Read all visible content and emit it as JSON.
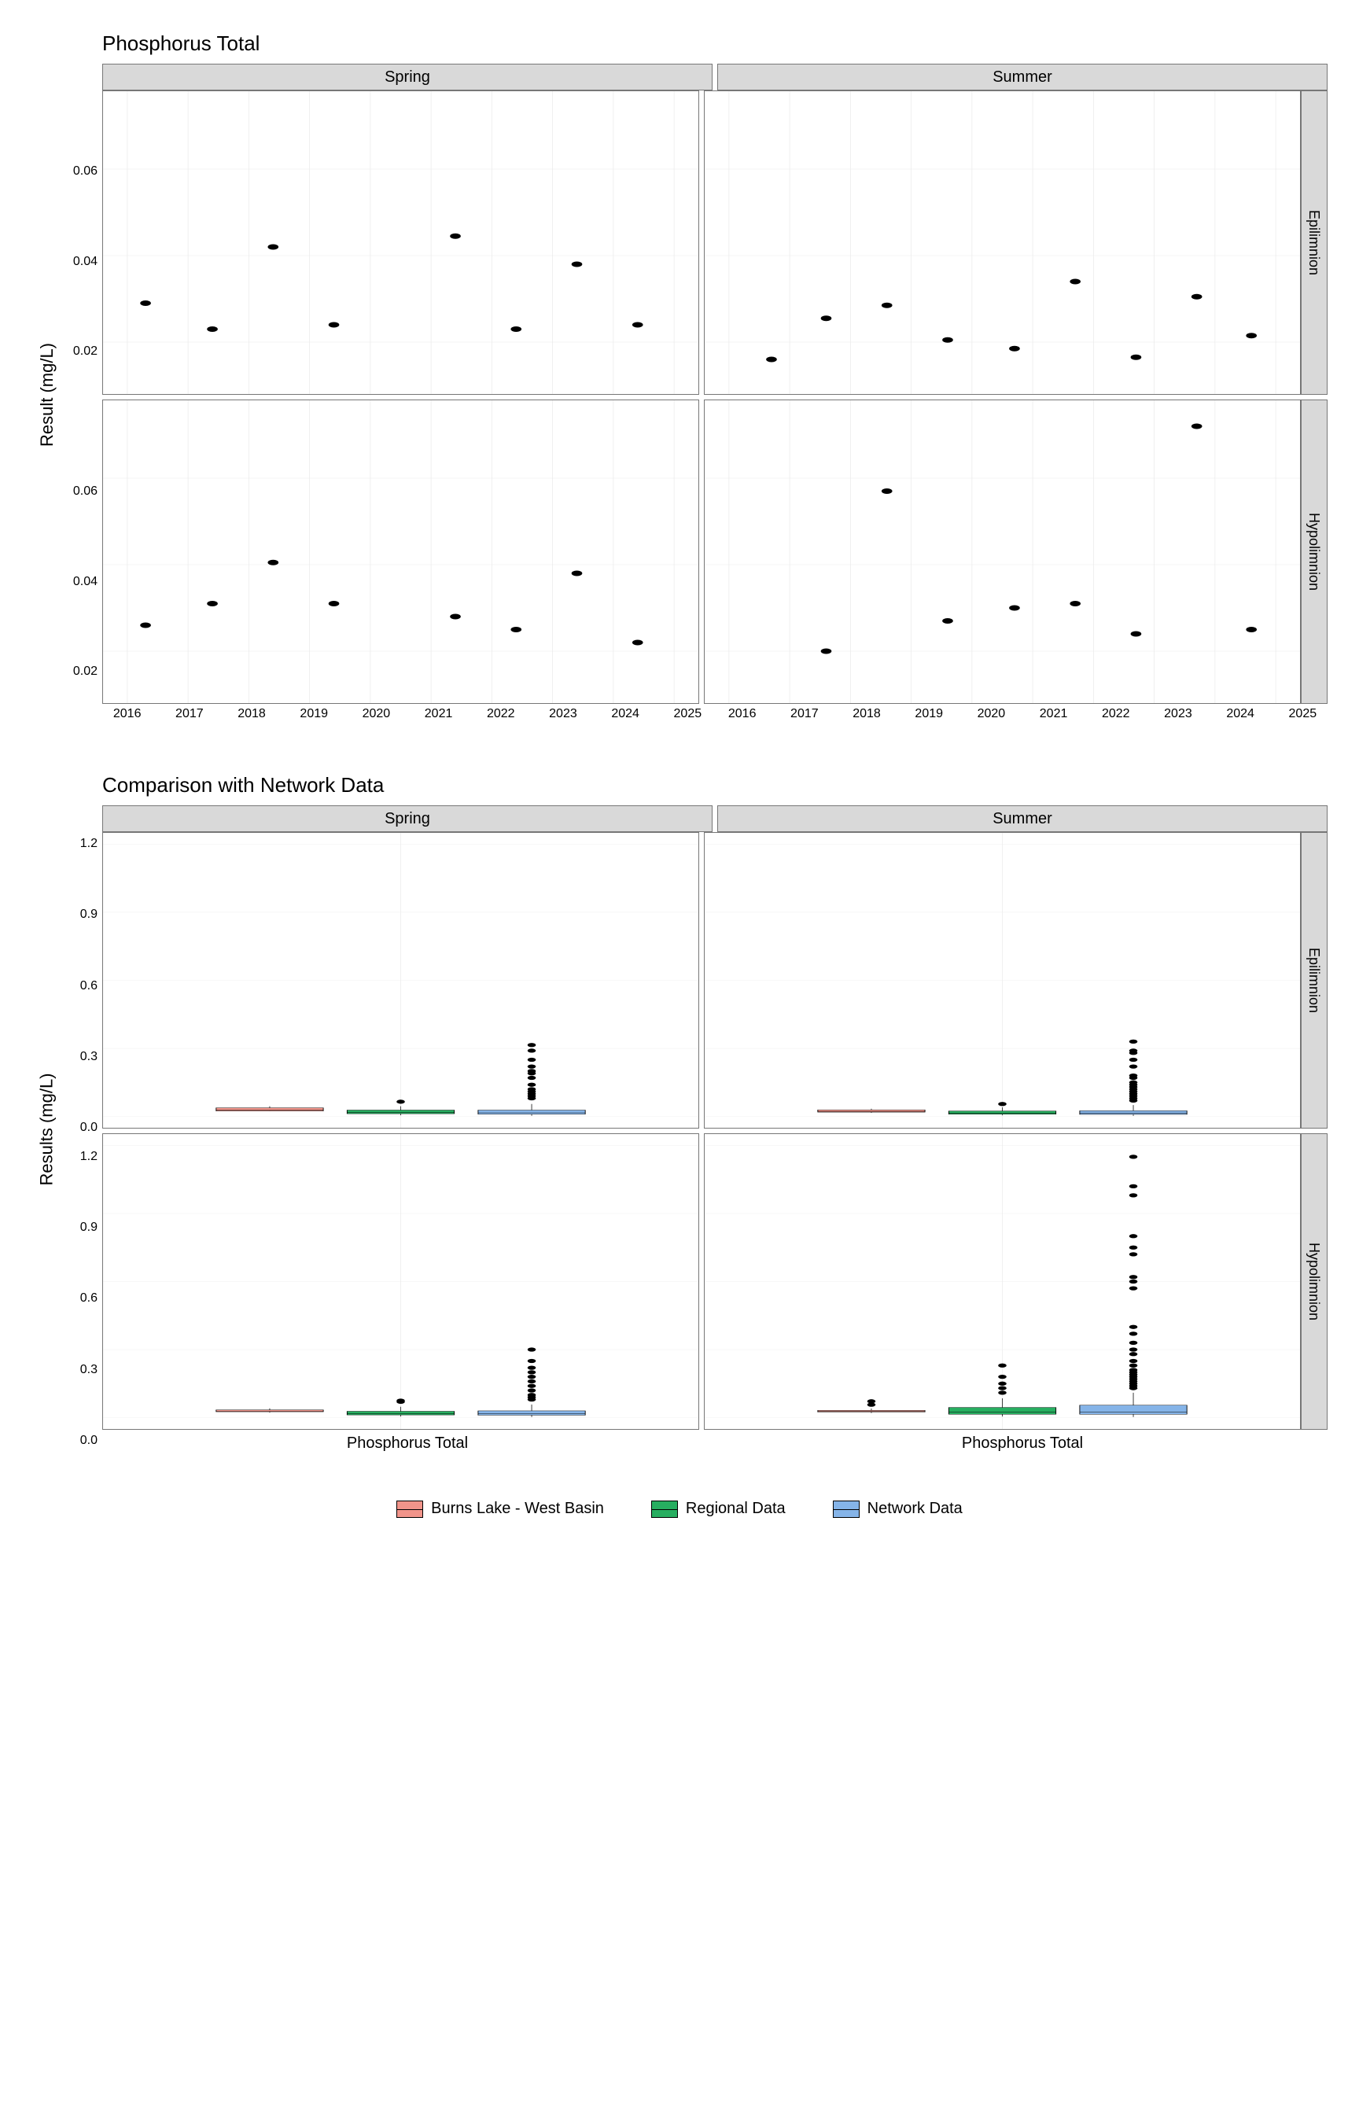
{
  "chart1": {
    "title": "Phosphorus Total",
    "ylabel": "Result (mg/L)",
    "col_facets": [
      "Spring",
      "Summer"
    ],
    "row_facets": [
      "Epilimnion",
      "Hypolimnion"
    ],
    "x_ticks": [
      2016,
      2017,
      2018,
      2019,
      2020,
      2021,
      2022,
      2023,
      2024,
      2025
    ],
    "y_ticks": [
      0.02,
      0.04,
      0.06
    ],
    "y_range": [
      0.008,
      0.078
    ]
  },
  "chart2": {
    "title": "Comparison with Network Data",
    "ylabel": "Results (mg/L)",
    "col_facets": [
      "Spring",
      "Summer"
    ],
    "row_facets": [
      "Epilimnion",
      "Hypolimnion"
    ],
    "x_category": "Phosphorus Total",
    "y_ticks": [
      0.0,
      0.3,
      0.6,
      0.9,
      1.2
    ],
    "y_range": [
      -0.05,
      1.25
    ]
  },
  "legend": {
    "items": [
      {
        "label": "Burns Lake - West Basin",
        "color": "#f1948a"
      },
      {
        "label": "Regional Data",
        "color": "#27ae60"
      },
      {
        "label": "Network Data",
        "color": "#85b4e8"
      }
    ]
  },
  "chart_data": [
    {
      "type": "scatter",
      "title": "Phosphorus Total",
      "xlabel": "",
      "ylabel": "Result (mg/L)",
      "facets": {
        "columns": [
          "Spring",
          "Summer"
        ],
        "rows": [
          "Epilimnion",
          "Hypolimnion"
        ]
      },
      "x_range": [
        2016,
        2025
      ],
      "y_range": [
        0.008,
        0.078
      ],
      "panels": {
        "Spring_Epilimnion": {
          "x": [
            2016.3,
            2017.4,
            2018.4,
            2019.4,
            2021.4,
            2022.4,
            2023.4,
            2024.4
          ],
          "y": [
            0.029,
            0.023,
            0.042,
            0.024,
            0.0445,
            0.023,
            0.038,
            0.024
          ]
        },
        "Summer_Epilimnion": {
          "x": [
            2016.7,
            2017.6,
            2018.6,
            2019.6,
            2020.7,
            2021.7,
            2022.7,
            2023.7,
            2024.6
          ],
          "y": [
            0.016,
            0.0255,
            0.0285,
            0.0205,
            0.0185,
            0.034,
            0.0165,
            0.0305,
            0.0215
          ]
        },
        "Spring_Hypolimnion": {
          "x": [
            2016.3,
            2017.4,
            2018.4,
            2019.4,
            2021.4,
            2022.4,
            2023.4,
            2024.4
          ],
          "y": [
            0.026,
            0.031,
            0.0405,
            0.031,
            0.028,
            0.025,
            0.038,
            0.022
          ]
        },
        "Summer_Hypolimnion": {
          "x": [
            2017.6,
            2018.6,
            2019.6,
            2020.7,
            2021.7,
            2022.7,
            2023.7,
            2024.6
          ],
          "y": [
            0.02,
            0.057,
            0.027,
            0.03,
            0.031,
            0.024,
            0.072,
            0.025
          ]
        }
      }
    },
    {
      "type": "box",
      "title": "Comparison with Network Data",
      "xlabel": "Phosphorus Total",
      "ylabel": "Results (mg/L)",
      "facets": {
        "columns": [
          "Spring",
          "Summer"
        ],
        "rows": [
          "Epilimnion",
          "Hypolimnion"
        ]
      },
      "y_range": [
        -0.05,
        1.25
      ],
      "series_order": [
        "Burns Lake - West Basin",
        "Regional Data",
        "Network Data"
      ],
      "colors": {
        "Burns Lake - West Basin": "#f1948a",
        "Regional Data": "#27ae60",
        "Network Data": "#85b4e8"
      },
      "panels": {
        "Spring_Epilimnion": {
          "Burns Lake - West Basin": {
            "min": 0.023,
            "q1": 0.024,
            "median": 0.028,
            "q3": 0.038,
            "max": 0.045,
            "outliers": []
          },
          "Regional Data": {
            "min": 0.005,
            "q1": 0.012,
            "median": 0.018,
            "q3": 0.028,
            "max": 0.045,
            "outliers": [
              0.065
            ]
          },
          "Network Data": {
            "min": 0.003,
            "q1": 0.01,
            "median": 0.016,
            "q3": 0.028,
            "max": 0.055,
            "outliers": [
              0.08,
              0.09,
              0.1,
              0.11,
              0.12,
              0.14,
              0.17,
              0.19,
              0.2,
              0.22,
              0.25,
              0.29,
              0.315
            ]
          }
        },
        "Summer_Epilimnion": {
          "Burns Lake - West Basin": {
            "min": 0.016,
            "q1": 0.019,
            "median": 0.022,
            "q3": 0.029,
            "max": 0.034,
            "outliers": []
          },
          "Regional Data": {
            "min": 0.005,
            "q1": 0.01,
            "median": 0.015,
            "q3": 0.024,
            "max": 0.04,
            "outliers": [
              0.055
            ]
          },
          "Network Data": {
            "min": 0.003,
            "q1": 0.009,
            "median": 0.015,
            "q3": 0.025,
            "max": 0.05,
            "outliers": [
              0.07,
              0.08,
              0.09,
              0.1,
              0.11,
              0.12,
              0.13,
              0.14,
              0.15,
              0.17,
              0.18,
              0.22,
              0.25,
              0.28,
              0.29,
              0.33
            ]
          }
        },
        "Spring_Hypolimnion": {
          "Burns Lake - West Basin": {
            "min": 0.022,
            "q1": 0.026,
            "median": 0.029,
            "q3": 0.034,
            "max": 0.041,
            "outliers": []
          },
          "Regional Data": {
            "min": 0.005,
            "q1": 0.012,
            "median": 0.018,
            "q3": 0.028,
            "max": 0.048,
            "outliers": [
              0.07,
              0.075
            ]
          },
          "Network Data": {
            "min": 0.003,
            "q1": 0.011,
            "median": 0.018,
            "q3": 0.03,
            "max": 0.058,
            "outliers": [
              0.08,
              0.09,
              0.1,
              0.12,
              0.14,
              0.16,
              0.18,
              0.2,
              0.22,
              0.25,
              0.3
            ]
          }
        },
        "Summer_Hypolimnion": {
          "Burns Lake - West Basin": {
            "min": 0.02,
            "q1": 0.025,
            "median": 0.028,
            "q3": 0.032,
            "max": 0.04,
            "outliers": [
              0.057,
              0.072
            ]
          },
          "Regional Data": {
            "min": 0.005,
            "q1": 0.015,
            "median": 0.025,
            "q3": 0.045,
            "max": 0.085,
            "outliers": [
              0.11,
              0.13,
              0.15,
              0.18,
              0.23
            ]
          },
          "Network Data": {
            "min": 0.003,
            "q1": 0.015,
            "median": 0.025,
            "q3": 0.055,
            "max": 0.11,
            "outliers": [
              0.13,
              0.14,
              0.15,
              0.16,
              0.17,
              0.18,
              0.19,
              0.2,
              0.21,
              0.23,
              0.25,
              0.28,
              0.3,
              0.33,
              0.37,
              0.4,
              0.57,
              0.6,
              0.62,
              0.72,
              0.75,
              0.8,
              0.98,
              1.02,
              1.15
            ]
          }
        }
      }
    }
  ]
}
